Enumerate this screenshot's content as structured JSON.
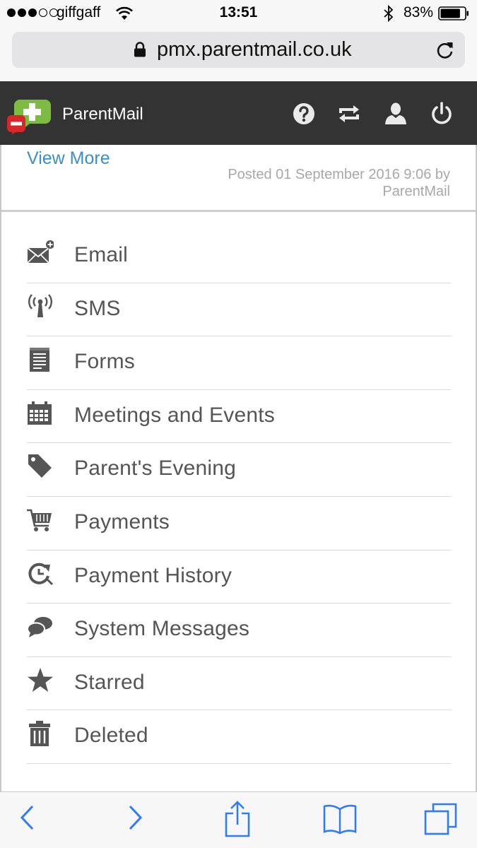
{
  "status_bar": {
    "carrier": "giffgaff",
    "time": "13:51",
    "battery_percent": "83%",
    "battery_level": 0.83,
    "signal_bars_filled": 3,
    "signal_bars_total": 5
  },
  "browser": {
    "url": "pmx.parentmail.co.uk"
  },
  "app": {
    "title": "ParentMail",
    "header_icons": [
      "help-icon",
      "switch-icon",
      "user-icon",
      "power-icon"
    ],
    "colors": {
      "header_bg": "#333333",
      "link": "#3b8fc8",
      "logo_green": "#7dbb42",
      "logo_red": "#d9262b"
    }
  },
  "post": {
    "view_more": "View More",
    "posted_line1": "Posted 01 September 2016 9:06 by",
    "posted_line2": "ParentMail"
  },
  "menu": [
    {
      "label": "Email",
      "icon": "email-add-icon"
    },
    {
      "label": "SMS",
      "icon": "antenna-icon"
    },
    {
      "label": "Forms",
      "icon": "form-icon"
    },
    {
      "label": "Meetings and Events",
      "icon": "calendar-icon"
    },
    {
      "label": "Parent's Evening",
      "icon": "tag-icon"
    },
    {
      "label": "Payments",
      "icon": "cart-icon"
    },
    {
      "label": "Payment History",
      "icon": "history-icon"
    },
    {
      "label": "System Messages",
      "icon": "chat-icon"
    },
    {
      "label": "Starred",
      "icon": "star-icon"
    },
    {
      "label": "Deleted",
      "icon": "trash-icon"
    }
  ],
  "toolbar": {
    "icons": [
      "back-icon",
      "forward-icon",
      "share-icon",
      "bookmarks-icon",
      "tabs-icon"
    ],
    "tint": "#2f7cf6"
  }
}
